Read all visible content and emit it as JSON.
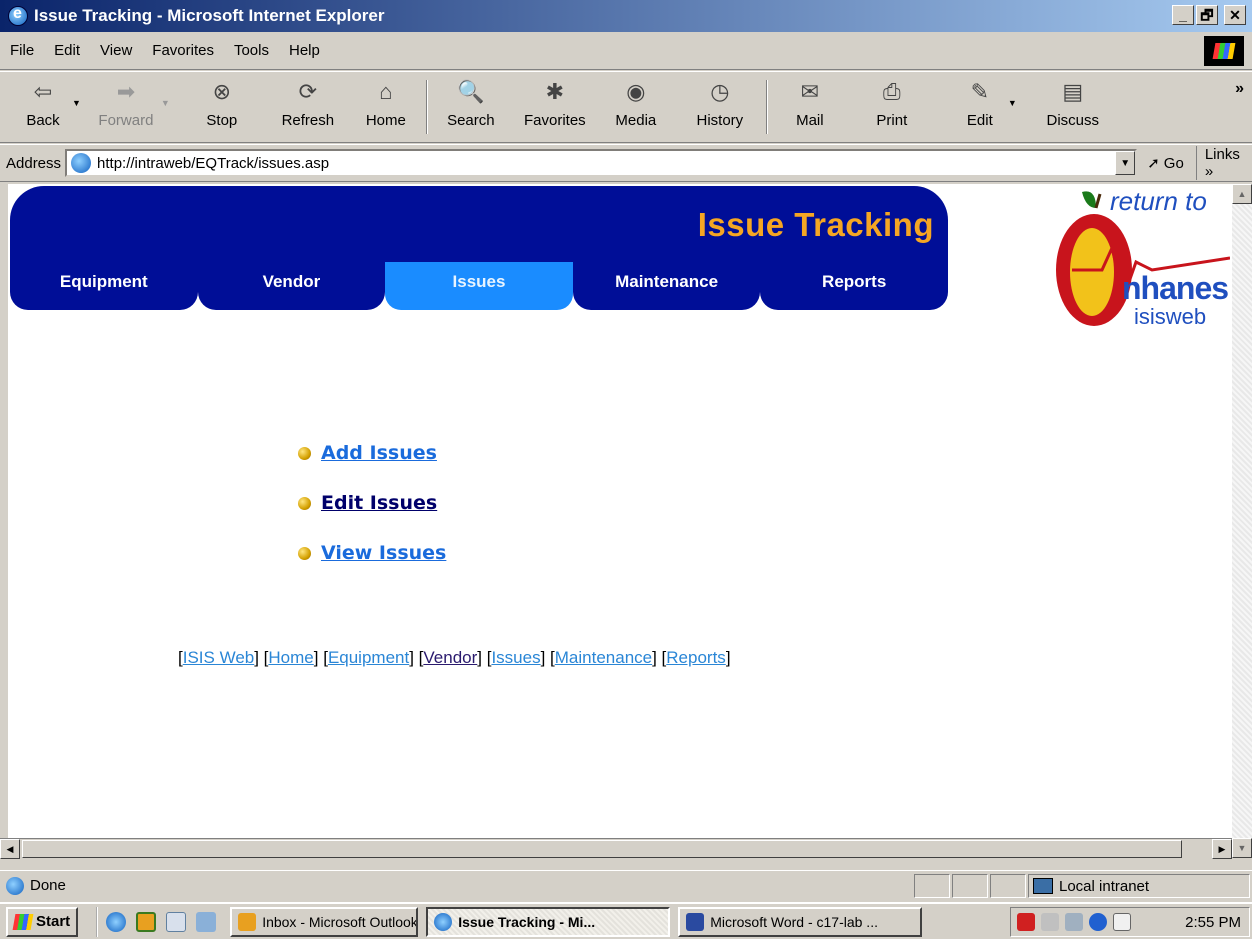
{
  "window": {
    "title": "Issue Tracking - Microsoft Internet Explorer",
    "buttons": {
      "minimize": "_",
      "maximize": "🗗",
      "close": "✕"
    }
  },
  "menu": {
    "items": [
      "File",
      "Edit",
      "View",
      "Favorites",
      "Tools",
      "Help"
    ]
  },
  "toolbar": {
    "buttons": [
      {
        "label": "Back",
        "icon": "back-arrow-icon",
        "glyph": "⇦"
      },
      {
        "label": "Forward",
        "icon": "forward-arrow-icon",
        "glyph": "➡"
      },
      {
        "label": "Stop",
        "icon": "stop-icon",
        "glyph": "⊗"
      },
      {
        "label": "Refresh",
        "icon": "refresh-icon",
        "glyph": "⟳"
      },
      {
        "label": "Home",
        "icon": "home-icon",
        "glyph": "⌂"
      },
      {
        "label": "Search",
        "icon": "search-icon",
        "glyph": "🔍"
      },
      {
        "label": "Favorites",
        "icon": "favorites-icon",
        "glyph": "✱"
      },
      {
        "label": "Media",
        "icon": "media-icon",
        "glyph": "◉"
      },
      {
        "label": "History",
        "icon": "history-icon",
        "glyph": "◷"
      },
      {
        "label": "Mail",
        "icon": "mail-icon",
        "glyph": "✉"
      },
      {
        "label": "Print",
        "icon": "print-icon",
        "glyph": "⎙"
      },
      {
        "label": "Edit",
        "icon": "edit-icon",
        "glyph": "✎"
      },
      {
        "label": "Discuss",
        "icon": "discuss-icon",
        "glyph": "▤"
      }
    ],
    "overflow": "»"
  },
  "address": {
    "label": "Address",
    "url": "http://intraweb/EQTrack/issues.asp",
    "go": "Go",
    "links": "Links »"
  },
  "page": {
    "banner_title": "Issue Tracking",
    "tabs": [
      "Equipment",
      "Vendor",
      "Issues",
      "Maintenance",
      "Reports"
    ],
    "active_tab": "Issues",
    "logo": {
      "line1": "return to",
      "line2": "nhanes",
      "line3": "isisweb"
    },
    "issue_links": [
      "Add Issues",
      "Edit Issues",
      "View Issues"
    ],
    "footer_links": [
      "ISIS Web",
      "Home",
      "Equipment",
      "Vendor",
      "Issues",
      "Maintenance",
      "Reports"
    ]
  },
  "status": {
    "text": "Done",
    "zone": "Local intranet"
  },
  "taskbar": {
    "start": "Start",
    "tasks": [
      "Inbox - Microsoft Outlook",
      "Issue Tracking - Mi...",
      "Microsoft Word - c17-lab ..."
    ],
    "active_task_index": 1,
    "clock": "2:55 PM"
  },
  "colors": {
    "banner": "#000e97",
    "active_tab": "#1a8cff",
    "title_accent": "#f5a623",
    "link": "#1a6bdc"
  }
}
